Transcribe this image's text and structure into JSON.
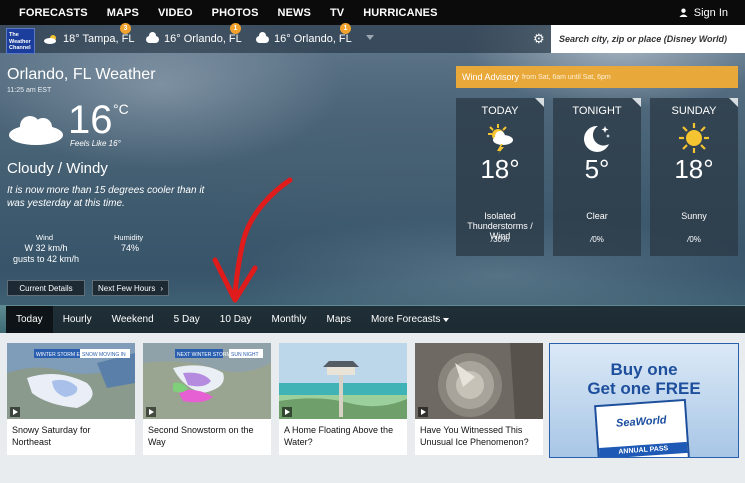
{
  "nav": {
    "items": [
      "FORECASTS",
      "MAPS",
      "VIDEO",
      "PHOTOS",
      "NEWS",
      "TV",
      "HURRICANES"
    ],
    "signin_label": "Sign In"
  },
  "brand": {
    "logo_text": "The Weather Channel"
  },
  "locations": [
    {
      "label": "18° Tampa, FL",
      "badge": "3",
      "icon": "partly-cloudy-icon"
    },
    {
      "label": "16° Orlando, FL",
      "badge": "1",
      "icon": "cloudy-icon"
    },
    {
      "label": "16° Orlando, FL",
      "badge": "1",
      "icon": "cloudy-icon"
    }
  ],
  "search": {
    "placeholder": "Search city, zip or place (Disney World)"
  },
  "current": {
    "city": "Orlando, FL Weather",
    "time": "11:25 am EST",
    "temp": "16",
    "unit": "°C",
    "feels_like": "Feels Like 16°",
    "phrase": "Cloudy / Windy",
    "note": "It is now more than 15 degrees cooler than it was yesterday at this time.",
    "wind_label": "Wind",
    "wind_value_1": "W 32 km/h",
    "wind_value_2": "gusts to 42 km/h",
    "humidity_label": "Humidity",
    "humidity_value": "74%",
    "current_details_label": "Current Details",
    "next_hours_label": "Next Few Hours"
  },
  "advisory": {
    "title": "Wind Advisory",
    "detail": "from Sat, 6am until Sat, 6pm"
  },
  "forecast": [
    {
      "name": "TODAY",
      "temp": "18°",
      "desc1": "Isolated",
      "desc2": "Thunderstorms /",
      "desc3": "Wind",
      "precip": "30%",
      "icon": "sun-storm-icon"
    },
    {
      "name": "TONIGHT",
      "temp": "5°",
      "desc1": "",
      "desc2": "Clear",
      "desc3": "",
      "precip": "0%",
      "icon": "moon-icon"
    },
    {
      "name": "SUNDAY",
      "temp": "18°",
      "desc1": "",
      "desc2": "Sunny",
      "desc3": "",
      "precip": "0%",
      "icon": "sun-icon"
    }
  ],
  "tabs": [
    "Today",
    "Hourly",
    "Weekend",
    "5 Day",
    "10 Day",
    "Monthly",
    "Maps",
    "More Forecasts"
  ],
  "videos": [
    {
      "title": "Snowy Saturday for Northeast",
      "tag1": "WINTER STORM ELI",
      "tag2": "SNOW MOVING IN"
    },
    {
      "title": "Second Snowstorm on the Way",
      "tag1": "NEXT WINTER STORM",
      "tag2": "SUN NIGHT"
    },
    {
      "title": "A Home Floating Above the Water?"
    },
    {
      "title": "Have You Witnessed This Unusual Ice Phenomenon?"
    }
  ],
  "ad": {
    "line1": "Buy one",
    "line2": "Get one FREE",
    "brand": "SeaWorld",
    "pass": "ANNUAL PASS"
  },
  "colors": {
    "advisory": "#e9a93a",
    "badge": "#f2a22d",
    "arrow": "#e01b1b",
    "logo": "#1b3e9c"
  }
}
